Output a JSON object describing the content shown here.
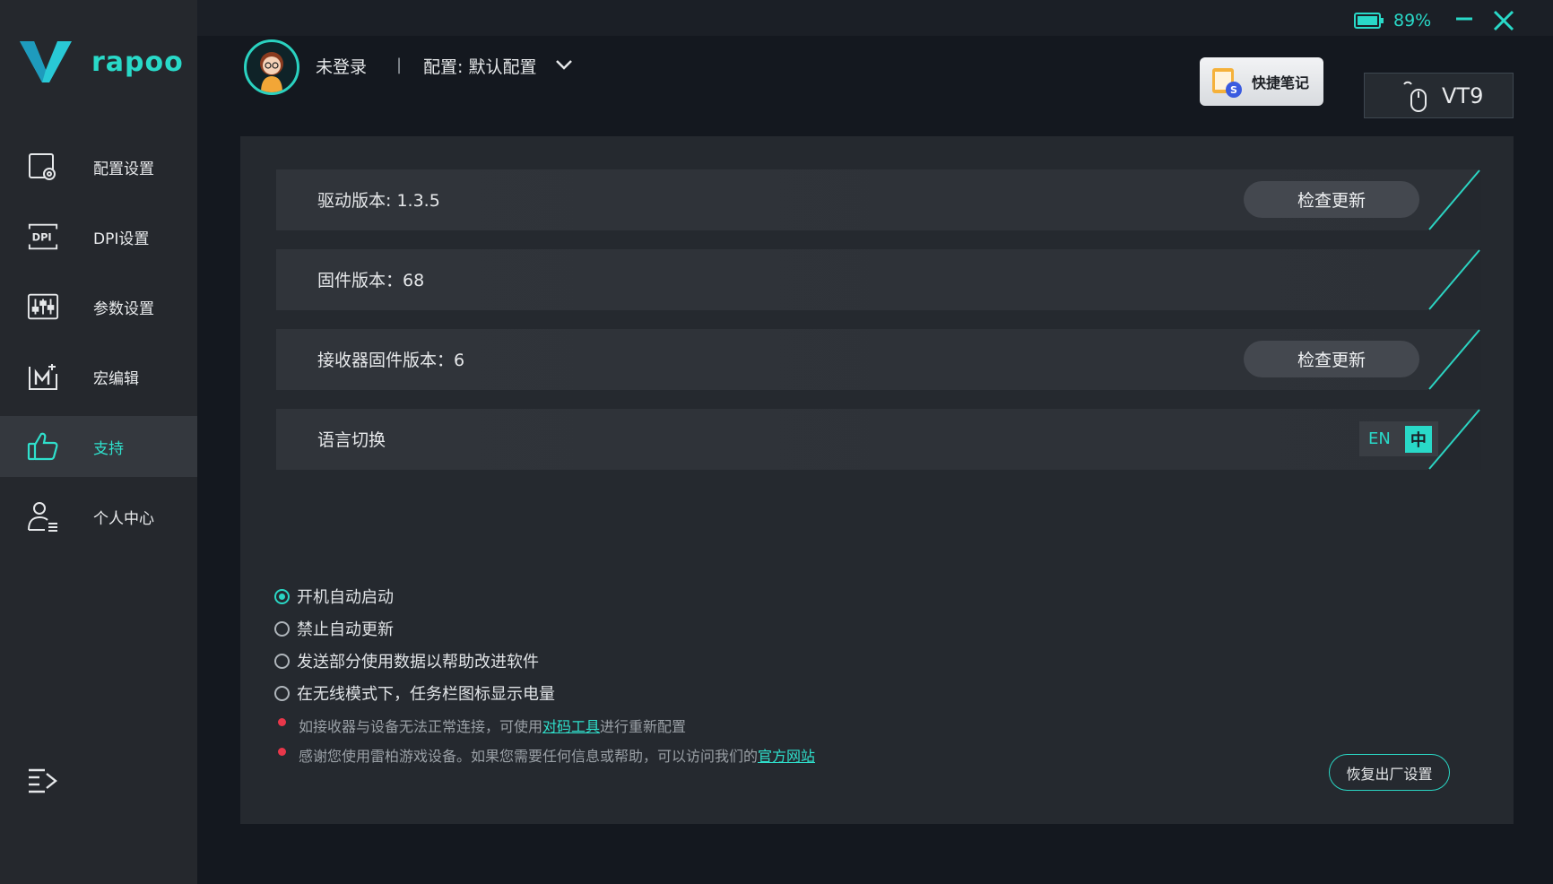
{
  "brand": {
    "logo_text": "rapoo",
    "accent": "#29d9c8"
  },
  "sidebar": {
    "items": [
      {
        "label": "配置设置",
        "icon": "config-settings-icon",
        "active": false
      },
      {
        "label": "DPI设置",
        "icon": "dpi-icon",
        "active": false
      },
      {
        "label": "参数设置",
        "icon": "sliders-icon",
        "active": false
      },
      {
        "label": "宏编辑",
        "icon": "macro-icon",
        "active": false
      },
      {
        "label": "支持",
        "icon": "thumbs-up-icon",
        "active": true
      },
      {
        "label": "个人中心",
        "icon": "user-center-icon",
        "active": false
      }
    ],
    "collapse_icon": "menu-collapse-icon"
  },
  "topbar": {
    "battery": "89%"
  },
  "header": {
    "user": "未登录",
    "separator": "|",
    "config": "配置: 默认配置",
    "quick_notes": "快捷笔记",
    "device": "VT9"
  },
  "support": {
    "rows": [
      {
        "label": "驱动版本: 1.3.5",
        "button": "检查更新"
      },
      {
        "label": "固件版本：68"
      },
      {
        "label": "接收器固件版本：6",
        "button": "检查更新"
      },
      {
        "label": "语言切换"
      }
    ],
    "language": {
      "en": "EN",
      "zh": "中",
      "selected": "中"
    },
    "options": [
      {
        "label": "开机自动启动",
        "checked": true
      },
      {
        "label": "禁止自动更新",
        "checked": false
      },
      {
        "label": "发送部分使用数据以帮助改进软件",
        "checked": false
      },
      {
        "label": "在无线模式下，任务栏图标显示电量",
        "checked": false
      }
    ],
    "notes": [
      {
        "before": "如接收器与设备无法正常连接，可使用",
        "link": "对码工具",
        "after": "进行重新配置"
      },
      {
        "before": "感谢您使用雷柏游戏设备。如果您需要任何信息或帮助，可以访问我们的",
        "link": "官方网站",
        "after": ""
      }
    ],
    "reset": "恢复出厂设置"
  }
}
